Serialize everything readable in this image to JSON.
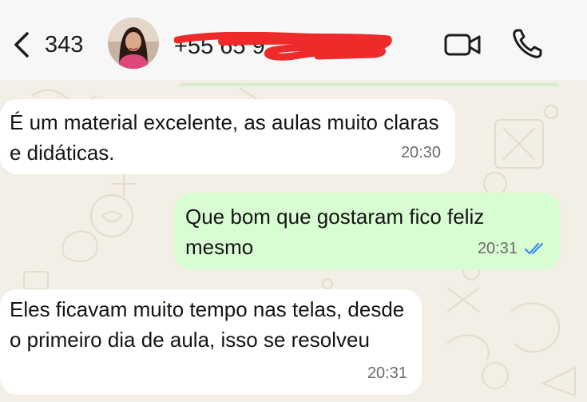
{
  "header": {
    "back_count": "343",
    "contact_name": "+55 65 9",
    "contact_redacted": true
  },
  "messages": [
    {
      "direction": "incoming",
      "text": "É um material excelente, as aulas muito claras e didáticas.",
      "time": "20:30"
    },
    {
      "direction": "outgoing",
      "text": "Que bom que gostaram fico feliz mesmo",
      "time": "20:31",
      "status": "read"
    },
    {
      "direction": "incoming",
      "text": "Eles ficavam muito tempo nas telas, desde o primeiro dia de aula, isso se resolveu",
      "time": "20:31"
    }
  ],
  "colors": {
    "incoming_bubble": "#ffffff",
    "outgoing_bubble": "#d9fdd3",
    "read_ticks": "#3b8ef0",
    "chat_background": "#f3efe6",
    "redaction": "#ee2a2a"
  },
  "icons": [
    "chevron-left-icon",
    "video-camera-icon",
    "phone-icon",
    "double-check-icon"
  ]
}
